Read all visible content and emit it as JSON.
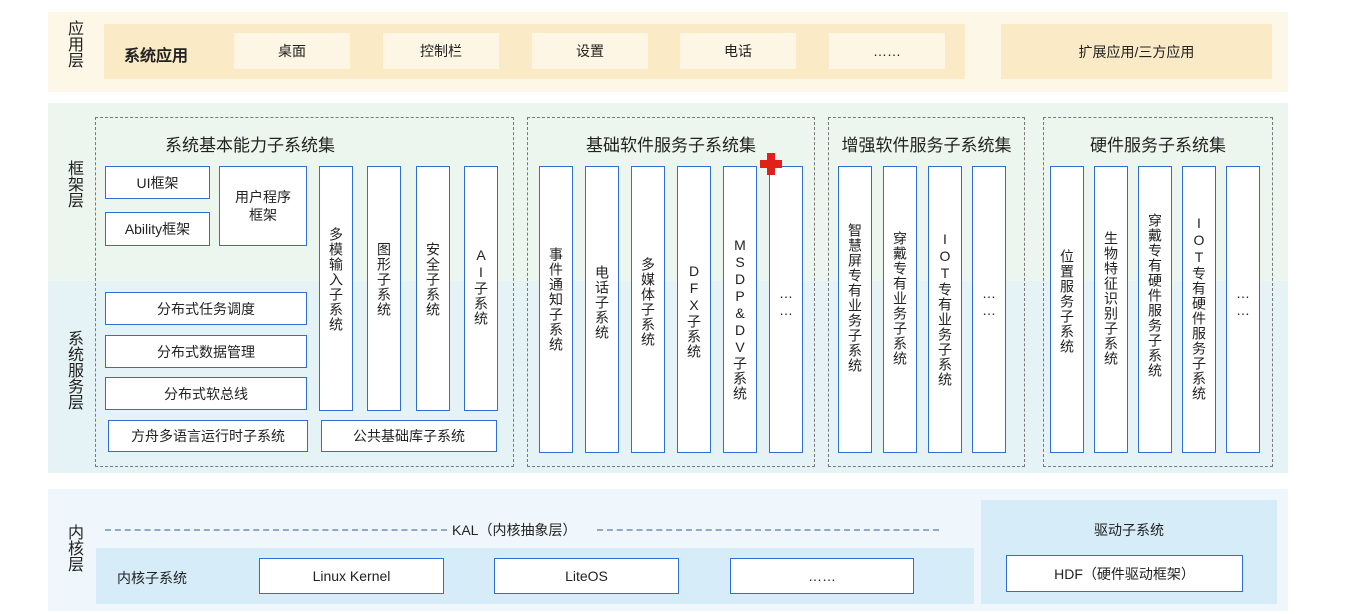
{
  "layers": {
    "app": "应用层",
    "framework": "框架层",
    "service": "系统服务层",
    "kernel": "内核层"
  },
  "app_layer": {
    "system_apps_title": "系统应用",
    "apps": [
      "桌面",
      "控制栏",
      "设置",
      "电话",
      "……"
    ],
    "extension": "扩展应用/三方应用"
  },
  "groups": {
    "basic": {
      "title": "系统基本能力子系统集",
      "ui": "UI框架",
      "ability": "Ability框架",
      "user_program": "用户程序框架",
      "vertical": [
        "多模输入子系统",
        "图形子系统",
        "安全子系统",
        "AI子系统"
      ],
      "distributed": [
        "分布式任务调度",
        "分布式数据管理",
        "分布式软总线"
      ],
      "ark_runtime": "方舟多语言运行时子系统",
      "common_lib": "公共基础库子系统"
    },
    "software": {
      "title": "基础软件服务子系统集",
      "items": [
        "事件通知子系统",
        "电话子系统",
        "多媒体子系统",
        "DFX子系统",
        "MSDP&DV子系统",
        "……"
      ]
    },
    "enhanced": {
      "title": "增强软件服务子系统集",
      "items": [
        "智慧屏专有业务子系统",
        "穿戴专有业务子系统",
        "IOT专有业务子系统",
        "……"
      ]
    },
    "hardware": {
      "title": "硬件服务子系统集",
      "items": [
        "位置服务子系统",
        "生物特征识别子系统",
        "穿戴专有硬件服务子系统",
        "IOT专有硬件服务子系统",
        "……"
      ]
    }
  },
  "kernel_layer": {
    "kal": "KAL（内核抽象层）",
    "kernel_subsystem": "内核子系统",
    "kernels": [
      "Linux Kernel",
      "LiteOS",
      "……"
    ],
    "driver_title": "驱动子系统",
    "hdf": "HDF（硬件驱动框架）"
  },
  "colors": {
    "app_bg": "#fdf7e7",
    "app_inner": "#faeac6",
    "framework_bg": "#ecf5ee",
    "service_bg": "#e6f3f6",
    "kernel_bg": "#eff7fc",
    "kernel_inner": "#d6ecf8",
    "border_blue": "#2e6fd4",
    "plus_red": "#e0201a"
  }
}
